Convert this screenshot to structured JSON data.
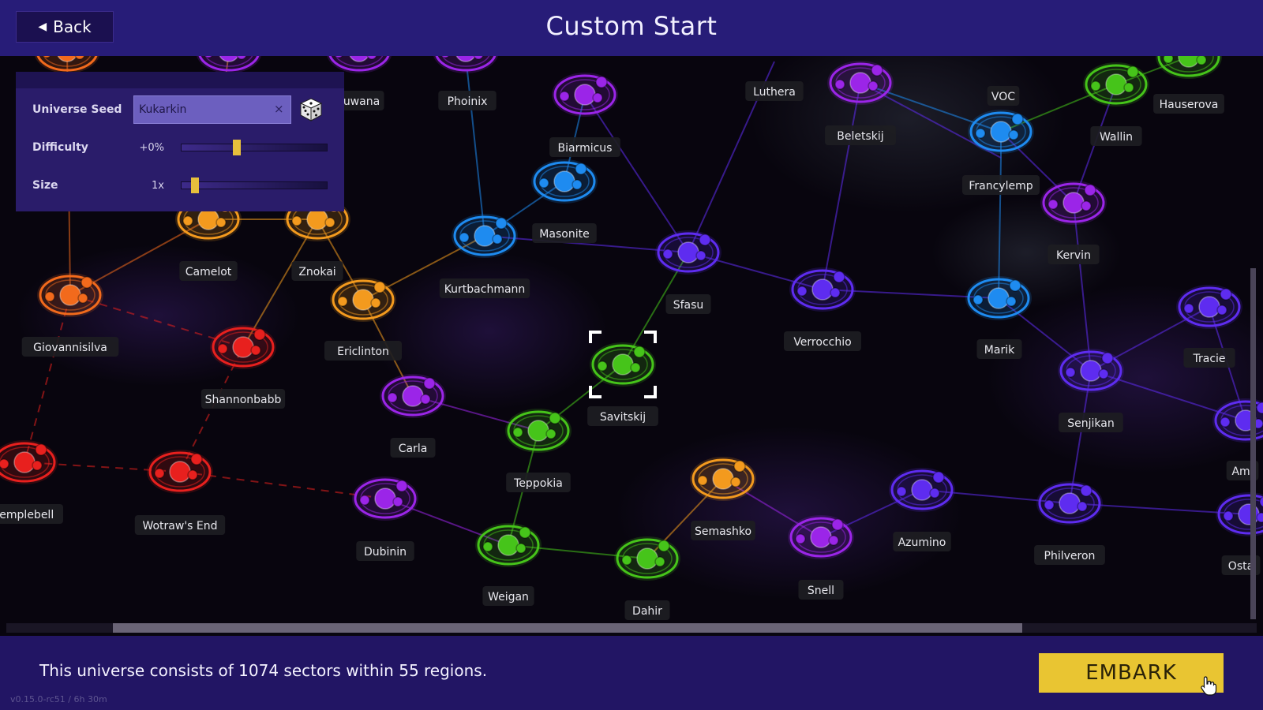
{
  "header": {
    "back_label": "Back",
    "title": "Custom Start"
  },
  "settings": {
    "seed_label": "Universe Seed",
    "seed_value": "Kukarkin",
    "clear_symbol": "×",
    "difficulty_label": "Difficulty",
    "difficulty_value": "+0%",
    "difficulty_level": 0.37,
    "size_label": "Size",
    "size_value": "1x",
    "size_level": 0.07
  },
  "map": {
    "region_colors": {
      "orange": "#f39a1e",
      "red": "#e8201e",
      "redorange": "#f26a1c",
      "purple": "#9b25e8",
      "blue": "#1e8bf0",
      "green": "#46c41a",
      "indigo": "#5e2cf0"
    },
    "labels": [
      "Phoinix",
      "Luthera",
      "VOC",
      "Hauserova",
      "Biarmicus",
      "Beletskij",
      "Wallin",
      "Francylemp",
      "Masonite",
      "Kervin",
      "Camelot",
      "Znokai",
      "Kurtbachmann",
      "Sfasu",
      "Verrocchio",
      "Marik",
      "Tracie",
      "Giovannisilva",
      "Ericlinton",
      "Shannonbabb",
      "Savitskij",
      "Senjikan",
      "Carla",
      "Teppokia",
      "Semashko",
      "Azumino",
      "Philveron",
      "templebell",
      "Wotraw's End",
      "Dubinin",
      "Weigan",
      "Dahir",
      "Snell",
      "Ami",
      "Osta",
      "uwana"
    ]
  },
  "footer": {
    "summary": "This universe consists of 1074 sectors within 55 regions.",
    "version": "v0.15.0-rc51 / 6h 30m",
    "embark_label": "EMBARK"
  }
}
